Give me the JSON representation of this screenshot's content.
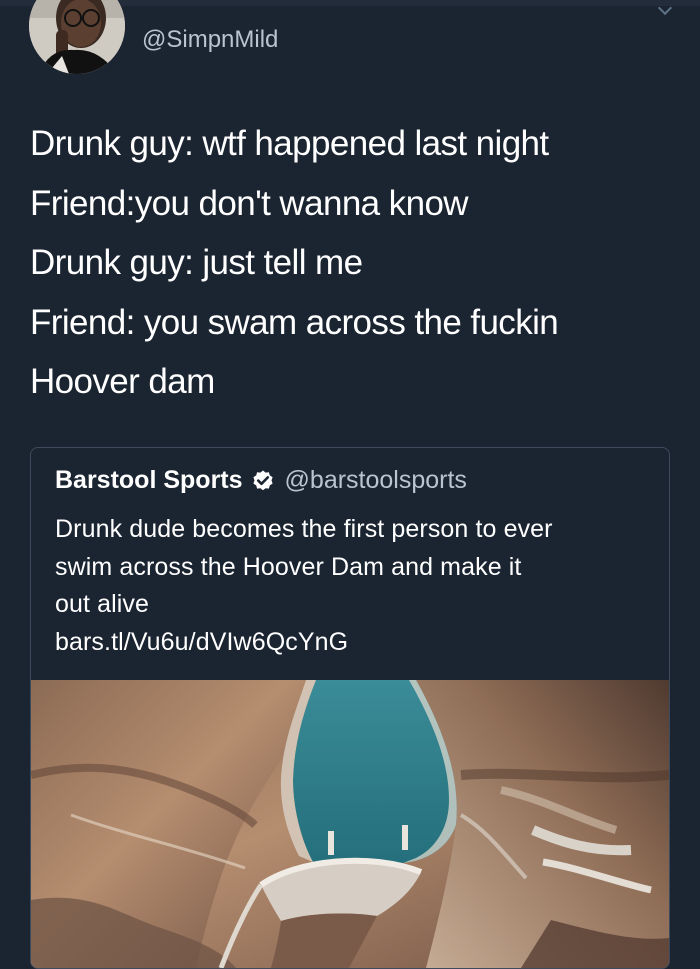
{
  "tweet": {
    "handle": "@SimpnMild",
    "lines": [
      "Drunk guy: wtf happened last night",
      "Friend:you don't wanna know",
      "Drunk guy: just tell me",
      "Friend: you swam across the fuckin",
      "Hoover dam"
    ]
  },
  "quoted_tweet": {
    "name": "Barstool Sports",
    "handle": "@barstoolsports",
    "lines": [
      "Drunk dude becomes the first person to ever",
      "swim across the Hoover Dam and make it",
      "out alive",
      "bars.tl/Vu6u/dVIw6QcYnG"
    ],
    "image_icon": "hoover-dam-aerial-photo",
    "verified_icon": "verified-badge-icon"
  },
  "icons": {
    "chevron": "chevron-down-icon",
    "avatar": "avatar"
  },
  "colors": {
    "background": "#1b2431",
    "text": "#ffffff",
    "secondary_text": "#b9c4d0",
    "card_border": "#3e4b5c",
    "water": "#2f7f8c"
  }
}
